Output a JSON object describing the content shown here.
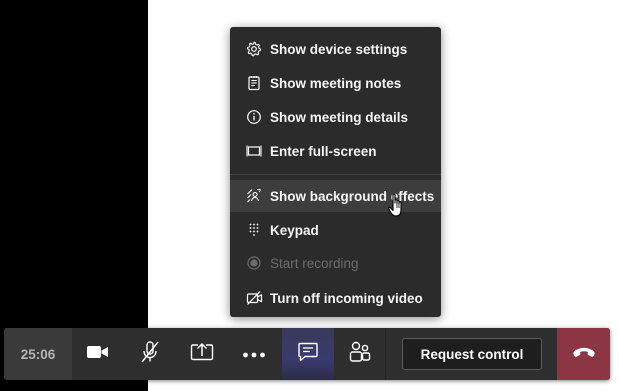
{
  "menu": {
    "items": [
      {
        "label": "Show device settings",
        "icon": "gear-icon"
      },
      {
        "label": "Show meeting notes",
        "icon": "notes-icon"
      },
      {
        "label": "Show meeting details",
        "icon": "info-icon"
      },
      {
        "label": "Enter full-screen",
        "icon": "fullscreen-icon"
      },
      {
        "label": "Show background effects",
        "icon": "background-effects-icon",
        "state": "hover"
      },
      {
        "label": "Keypad",
        "icon": "keypad-icon"
      },
      {
        "label": "Start recording",
        "icon": "record-icon",
        "state": "disabled"
      },
      {
        "label": "Turn off incoming video",
        "icon": "video-off-icon"
      }
    ]
  },
  "toolbar": {
    "timer": "25:06",
    "request_control_label": "Request control",
    "buttons": [
      "camera-icon",
      "mic-muted-icon",
      "share-screen-icon",
      "more-options-icon",
      "chat-icon",
      "participants-icon"
    ],
    "active_button": "chat-icon"
  },
  "colors": {
    "menu_bg": "#2b2b2b",
    "toolbar_bg": "#2e2e2e",
    "hangup_bg": "#8b3642",
    "active_bg": "#3a3a6e"
  }
}
